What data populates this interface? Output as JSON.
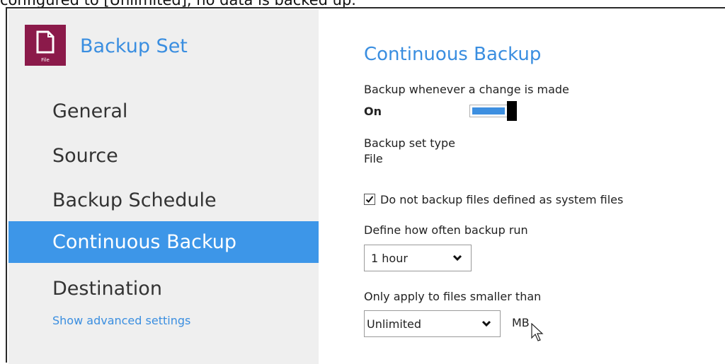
{
  "caption": "configured to [Unlimited], no data is backed up.",
  "sidebar": {
    "app_icon_caption": "File",
    "app_title": "Backup Set",
    "items": [
      {
        "label": "General"
      },
      {
        "label": "Source"
      },
      {
        "label": "Backup Schedule"
      },
      {
        "label": "Continuous Backup",
        "active": true
      },
      {
        "label": "Destination"
      }
    ],
    "advanced_link": "Show advanced settings"
  },
  "main": {
    "title": "Continuous Backup",
    "backup_on_change": {
      "label": "Backup whenever a change is made",
      "state_text": "On",
      "enabled": true
    },
    "backup_set_type": {
      "label": "Backup set type",
      "value": "File"
    },
    "skip_system_files": {
      "label": "Do not backup files defined as system files",
      "checked": true
    },
    "frequency": {
      "label": "Define how often backup run",
      "selected": "1 hour"
    },
    "size_limit": {
      "label": "Only apply to files smaller than",
      "selected": "Unlimited",
      "unit": "MB"
    }
  },
  "colors": {
    "accent": "#3a8ee0",
    "active_nav": "#3d96e8",
    "app_icon": "#8b1a4a",
    "sidebar_bg": "#efefef"
  }
}
